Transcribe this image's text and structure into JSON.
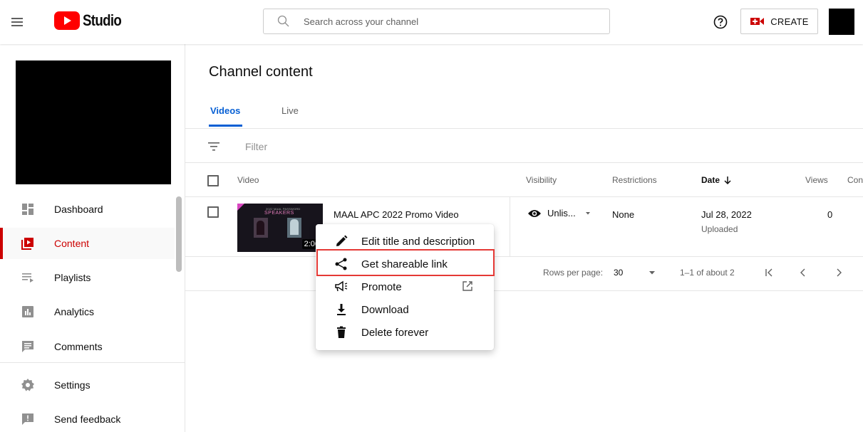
{
  "header": {
    "logo_text": "Studio",
    "search_placeholder": "Search across your channel",
    "create_label": "CREATE"
  },
  "sidebar": {
    "items": [
      {
        "label": "Dashboard",
        "icon": "dashboard-icon"
      },
      {
        "label": "Content",
        "icon": "content-icon",
        "active": true
      },
      {
        "label": "Playlists",
        "icon": "playlists-icon"
      },
      {
        "label": "Analytics",
        "icon": "analytics-icon"
      },
      {
        "label": "Comments",
        "icon": "comments-icon"
      },
      {
        "label": "Settings",
        "icon": "settings-icon"
      },
      {
        "label": "Send feedback",
        "icon": "feedback-icon"
      }
    ]
  },
  "main": {
    "title": "Channel content",
    "tabs": [
      {
        "label": "Videos",
        "active": true
      },
      {
        "label": "Live"
      }
    ],
    "filter_placeholder": "Filter",
    "columns": {
      "video": "Video",
      "visibility": "Visibility",
      "restrictions": "Restrictions",
      "date": "Date",
      "views": "Views",
      "comments": "Con"
    },
    "row": {
      "title": "MAAL APC 2022 Promo Video",
      "duration": "2:06",
      "thumb_subtitle": "2022 MAAL PASSWORD",
      "thumb_title": "SPEAKERS",
      "visibility": "Unlis...",
      "restrictions": "None",
      "date": "Jul 28, 2022",
      "date_status": "Uploaded",
      "views": "0"
    },
    "pagination": {
      "rows_per_page_label": "Rows per page:",
      "rows_per_page_value": "30",
      "range": "1–1 of about 2"
    }
  },
  "context_menu": {
    "items": [
      {
        "label": "Edit title and description",
        "icon": "pencil-icon"
      },
      {
        "label": "Get shareable link",
        "icon": "share-icon",
        "highlighted": true
      },
      {
        "label": "Promote",
        "icon": "megaphone-icon",
        "external": true
      },
      {
        "label": "Download",
        "icon": "download-icon"
      },
      {
        "label": "Delete forever",
        "icon": "trash-icon"
      }
    ]
  },
  "colors": {
    "brand_red": "#ff0000",
    "active_red": "#cc0000",
    "tab_blue": "#065fd4",
    "highlight_border": "#e53935"
  }
}
